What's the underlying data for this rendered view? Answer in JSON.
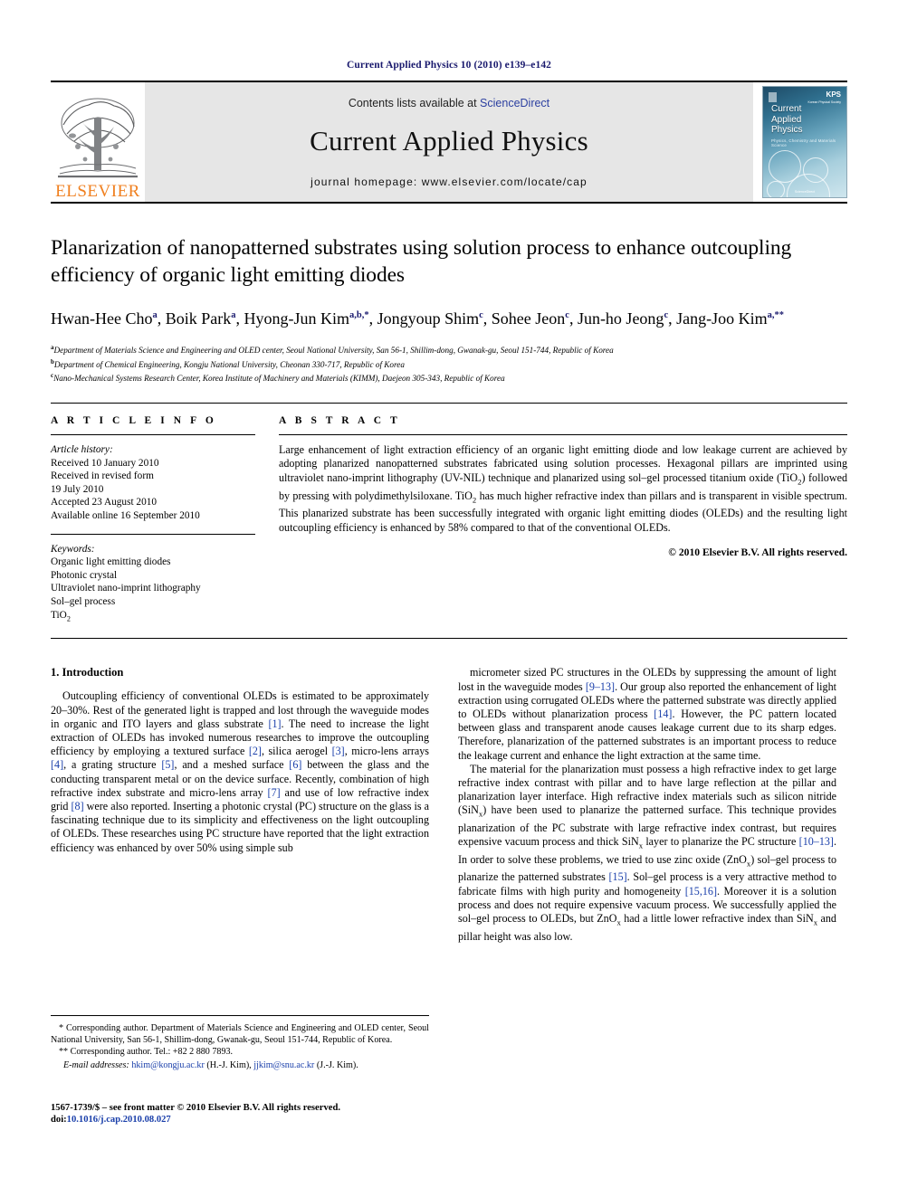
{
  "running_head": "Current Applied Physics 10 (2010) e139–e142",
  "masthead": {
    "publisher_name": "ELSEVIER",
    "contents_prefix": "Contents lists available at ",
    "contents_link": "ScienceDirect",
    "journal_title": "Current Applied Physics",
    "homepage": "journal homepage: www.elsevier.com/locate/cap",
    "cover": {
      "title_line1": "Current",
      "title_line2": "Applied",
      "title_line3": "Physics",
      "subtitle": "Physics, Chemistry and Materials Science",
      "society": "KPS",
      "society_sub": "Korean Physical Society",
      "footer": "ScienceDirect"
    }
  },
  "article": {
    "title": "Planarization of nanopatterned substrates using solution process to enhance outcoupling efficiency of organic light emitting diodes",
    "authors": [
      {
        "name": "Hwan-Hee Cho",
        "marks": "a"
      },
      {
        "name": "Boik Park",
        "marks": "a"
      },
      {
        "name": "Hyong-Jun Kim",
        "marks": "a,b,*"
      },
      {
        "name": "Jongyoup Shim",
        "marks": "c"
      },
      {
        "name": "Sohee Jeon",
        "marks": "c"
      },
      {
        "name": "Jun-ho Jeong",
        "marks": "c"
      },
      {
        "name": "Jang-Joo Kim",
        "marks": "a,**"
      }
    ],
    "affiliations": [
      {
        "mark": "a",
        "text": "Department of Materials Science and Engineering and OLED center, Seoul National University, San 56-1, Shillim-dong, Gwanak-gu, Seoul 151-744, Republic of Korea"
      },
      {
        "mark": "b",
        "text": "Department of Chemical Engineering, Kongju National University, Cheonan 330-717, Republic of Korea"
      },
      {
        "mark": "c",
        "text": "Nano-Mechanical Systems Research Center, Korea Institute of Machinery and Materials (KIMM), Daejeon 305-343, Republic of Korea"
      }
    ]
  },
  "article_info": {
    "heading": "A R T I C L E    I N F O",
    "history_label": "Article history:",
    "history": [
      "Received 10 January 2010",
      "Received in revised form",
      "19 July 2010",
      "Accepted 23 August 2010",
      "Available online 16 September 2010"
    ],
    "keywords_label": "Keywords:",
    "keywords": [
      "Organic light emitting diodes",
      "Photonic crystal",
      "Ultraviolet nano-imprint lithography",
      "Sol–gel process",
      "TiO2"
    ]
  },
  "abstract": {
    "heading": "A B S T R A C T",
    "text": "Large enhancement of light extraction efficiency of an organic light emitting diode and low leakage current are achieved by adopting planarized nanopatterned substrates fabricated using solution processes. Hexagonal pillars are imprinted using ultraviolet nano-imprint lithography (UV-NIL) technique and planarized using sol–gel processed titanium oxide (TiO2) followed by pressing with polydimethylsiloxane. TiO2 has much higher refractive index than pillars and is transparent in visible spectrum. This planarized substrate has been successfully integrated with organic light emitting diodes (OLEDs) and the resulting light outcoupling efficiency is enhanced by 58% compared to that of the conventional OLEDs.",
    "copyright": "© 2010 Elsevier B.V. All rights reserved."
  },
  "sections": {
    "intro_heading": "1.  Introduction",
    "left_paragraph": "Outcoupling efficiency of conventional OLEDs is estimated to be approximately 20–30%. Rest of the generated light is trapped and lost through the waveguide modes in organic and ITO layers and glass substrate [1]. The need to increase the light extraction of OLEDs has invoked numerous researches to improve the outcoupling efficiency by employing a textured surface [2], silica aerogel [3], micro-lens arrays [4], a grating structure [5], and a meshed surface [6] between the glass and the conducting transparent metal or on the device surface. Recently, combination of high refractive index substrate and micro-lens array [7] and use of low refractive index grid [8] were also reported. Inserting a photonic crystal (PC) structure on the glass is a fascinating technique due to its simplicity and effectiveness on the light outcoupling of OLEDs. These researches using PC structure have reported that the light extraction efficiency was enhanced by over 50% using simple sub",
    "right_paragraph_1": "micrometer sized PC structures in the OLEDs by suppressing the amount of light lost in the waveguide modes [9–13]. Our group also reported the enhancement of light extraction using corrugated OLEDs where the patterned substrate was directly applied to OLEDs without planarization process [14]. However, the PC pattern located between glass and transparent anode causes leakage current due to its sharp edges. Therefore, planarization of the patterned substrates is an important process to reduce the leakage current and enhance the light extraction at the same time.",
    "right_paragraph_2": "The material for the planarization must possess a high refractive index to get large refractive index contrast with pillar and to have large reflection at the pillar and planarization layer interface. High refractive index materials such as silicon nitride (SiNx) have been used to planarize the patterned surface. This technique provides planarization of the PC substrate with large refractive index contrast, but requires expensive vacuum process and thick SiNx layer to planarize the PC structure [10–13]. In order to solve these problems, we tried to use zinc oxide (ZnOx) sol–gel process to planarize the patterned substrates [15]. Sol–gel process is a very attractive method to fabricate films with high purity and homogeneity [15,16]. Moreover it is a solution process and does not require expensive vacuum process. We successfully applied the sol–gel process to OLEDs, but ZnOx had a little lower refractive index than SiNx and pillar height was also low."
  },
  "footnotes": {
    "corresponding_1": "* Corresponding author. Department of Materials Science and Engineering and OLED center, Seoul National University, San 56-1, Shillim-dong, Gwanak-gu, Seoul 151-744, Republic of Korea.",
    "corresponding_2": "** Corresponding author. Tel.: +82 2 880 7893.",
    "email_label": "E-mail addresses:",
    "email_1": "hkim@kongju.ac.kr",
    "email_1_who": "(H.-J. Kim),",
    "email_2": "jjkim@snu.ac.kr",
    "email_2_who": "(J.-J. Kim).",
    "issn_line": "1567-1739/$ – see front matter © 2010 Elsevier B.V. All rights reserved.",
    "doi_label": "doi:",
    "doi": "10.1016/j.cap.2010.08.027"
  },
  "colors": {
    "link_blue": "#2b3fa0",
    "ref_blue": "#1a3faa",
    "elsevier_orange": "#f08020",
    "running_head_navy": "#1a1a6e"
  }
}
